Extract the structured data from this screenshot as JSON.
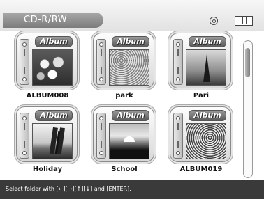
{
  "header": {
    "title": "CD-R/RW",
    "disc_icon": "disc-icon",
    "battery_icon": "battery-icon"
  },
  "folders": [
    {
      "label": "ALBUM008",
      "tab": "Album",
      "photo": "flowers"
    },
    {
      "label": "park",
      "tab": "Album",
      "photo": "park"
    },
    {
      "label": "Pari",
      "tab": "Album",
      "photo": "paris"
    },
    {
      "label": "Holiday",
      "tab": "Album",
      "photo": "holiday"
    },
    {
      "label": "School",
      "tab": "Album",
      "photo": "school"
    },
    {
      "label": "ALBUM019",
      "tab": "Album",
      "photo": "album019"
    }
  ],
  "footer": {
    "hint": "Select folder with [←][→][↑][↓] and [ENTER]."
  }
}
